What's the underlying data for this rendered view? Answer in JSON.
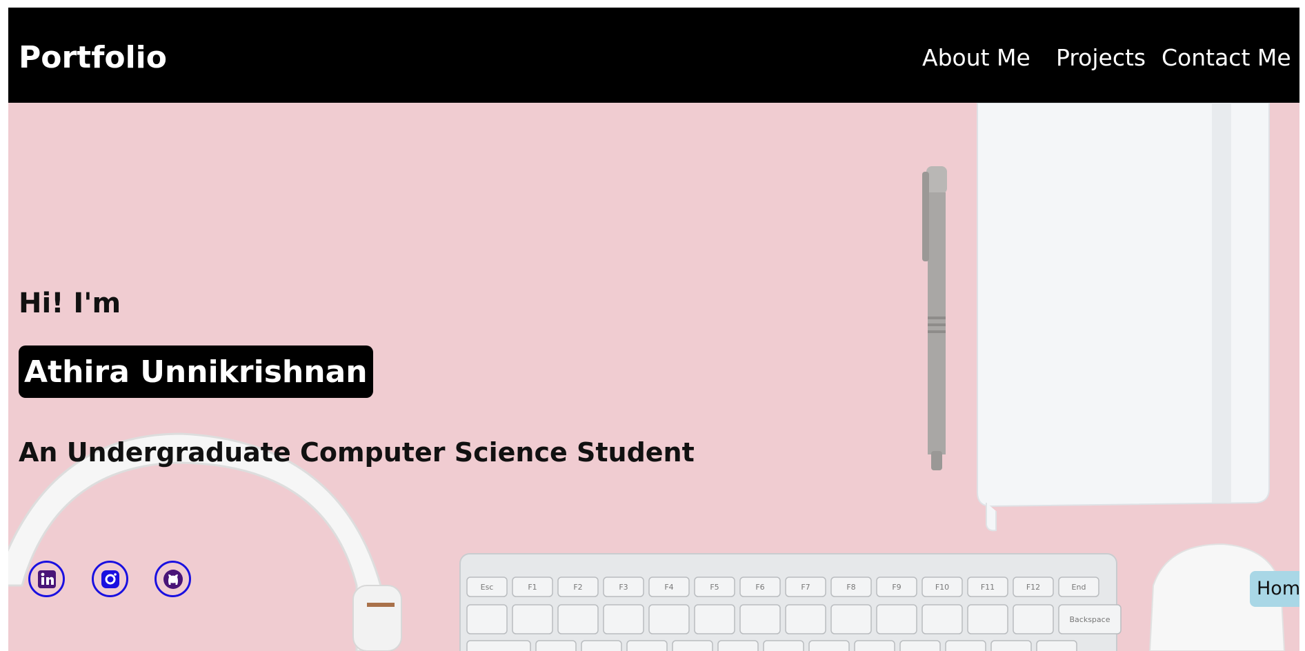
{
  "header": {
    "brand": "Portfolio",
    "nav": [
      "About Me",
      "Projects",
      "Contact Me"
    ]
  },
  "hero": {
    "greeting": "Hi! I'm",
    "name": "Athira Unnikrishnan",
    "subtitle": "An Undergraduate Computer Science Student"
  },
  "social_icons": [
    "linkedin-icon",
    "instagram-icon",
    "github-icon"
  ],
  "home_tab": "Home",
  "keyboard": {
    "row1": [
      "Esc",
      "F1",
      "F2",
      "F3",
      "F4",
      "F5",
      "F6",
      "F7",
      "F8",
      "F9",
      "F10",
      "F11",
      "F12",
      "End"
    ],
    "backspace": "Backspace"
  },
  "colors": {
    "navbar": "#000000",
    "hero_background": "#f0ccd1",
    "social_icon": "#1a10e0",
    "home_tab": "#a9d7e6"
  }
}
